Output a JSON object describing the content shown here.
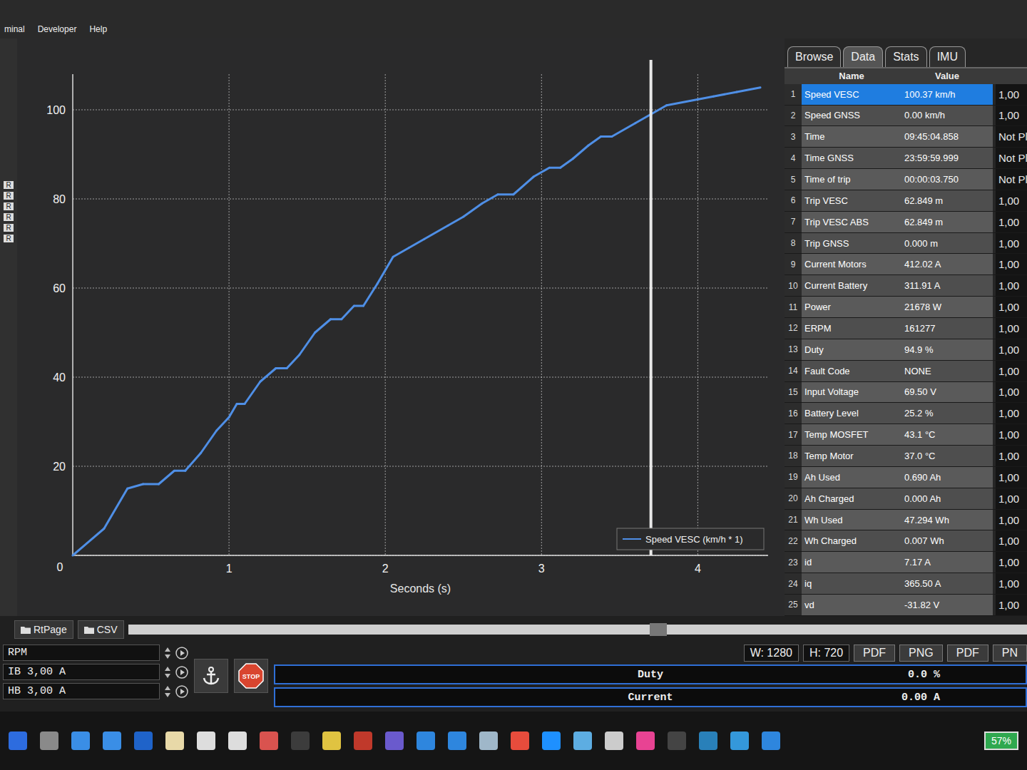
{
  "menu": [
    "minal",
    "Developer",
    "Help"
  ],
  "left_strip": [
    "R",
    "R",
    "R",
    "R",
    "R",
    "R"
  ],
  "chart": {
    "y_ticks": [
      "0",
      "20",
      "40",
      "60",
      "80",
      "100"
    ],
    "x_ticks": [
      "1",
      "2",
      "3",
      "4"
    ],
    "x_label": "Seconds (s)",
    "cursor": 3.7,
    "series": [
      {
        "name": "Speed VESC (km/h * 1)",
        "color": "#4f8fe6",
        "times": [
          0,
          0.2,
          0.35,
          0.45,
          0.55,
          0.65,
          0.72,
          0.82,
          0.92,
          1.0,
          1.05,
          1.1,
          1.2,
          1.3,
          1.37,
          1.45,
          1.55,
          1.65,
          1.72,
          1.8,
          1.86,
          1.95,
          2.05,
          2.15,
          2.25,
          2.4,
          2.5,
          2.62,
          2.72,
          2.82,
          2.95,
          3.05,
          3.12,
          3.2,
          3.3,
          3.38,
          3.45,
          3.6,
          3.7,
          3.8,
          3.95,
          4.1,
          4.25,
          4.4
        ],
        "values": [
          0,
          6,
          15,
          16,
          16,
          19,
          19,
          23,
          28,
          31,
          34,
          34,
          39,
          42,
          42,
          45,
          50,
          53,
          53,
          56,
          56,
          61,
          67,
          69,
          71,
          74,
          76,
          79,
          81,
          81,
          85,
          87,
          87,
          89,
          92,
          94,
          94,
          97,
          99,
          101,
          102,
          103,
          104,
          105
        ]
      }
    ]
  },
  "tabs": [
    {
      "label": "Browse",
      "selected": false
    },
    {
      "label": "Data",
      "selected": true
    },
    {
      "label": "Stats",
      "selected": false
    },
    {
      "label": "IMU",
      "selected": false
    }
  ],
  "table": {
    "columns": [
      "Name",
      "Value"
    ],
    "rows": [
      {
        "index": "1",
        "name": "Speed VESC",
        "value": "100.37 km/h",
        "scale": "1,00",
        "selected": true
      },
      {
        "index": "2",
        "name": "Speed GNSS",
        "value": "0.00 km/h",
        "scale": "1,00",
        "selected": false
      },
      {
        "index": "3",
        "name": "Time",
        "value": "09:45:04.858",
        "scale": "Not Pl",
        "selected": false
      },
      {
        "index": "4",
        "name": "Time GNSS",
        "value": "23:59:59.999",
        "scale": "Not Pl",
        "selected": false
      },
      {
        "index": "5",
        "name": "Time of trip",
        "value": "00:00:03.750",
        "scale": "Not Pl",
        "selected": false
      },
      {
        "index": "6",
        "name": "Trip VESC",
        "value": "62.849 m",
        "scale": "1,00",
        "selected": false
      },
      {
        "index": "7",
        "name": "Trip VESC ABS",
        "value": "62.849 m",
        "scale": "1,00",
        "selected": false
      },
      {
        "index": "8",
        "name": "Trip GNSS",
        "value": "0.000 m",
        "scale": "1,00",
        "selected": false
      },
      {
        "index": "9",
        "name": "Current Motors",
        "value": "412.02 A",
        "scale": "1,00",
        "selected": false
      },
      {
        "index": "10",
        "name": "Current Battery",
        "value": "311.91 A",
        "scale": "1,00",
        "selected": false
      },
      {
        "index": "11",
        "name": "Power",
        "value": "21678 W",
        "scale": "1,00",
        "selected": false
      },
      {
        "index": "12",
        "name": "ERPM",
        "value": "161277",
        "scale": "1,00",
        "selected": false
      },
      {
        "index": "13",
        "name": "Duty",
        "value": "94.9 %",
        "scale": "1,00",
        "selected": false
      },
      {
        "index": "14",
        "name": "Fault Code",
        "value": "NONE",
        "scale": "1,00",
        "selected": false
      },
      {
        "index": "15",
        "name": "Input Voltage",
        "value": "69.50 V",
        "scale": "1,00",
        "selected": false
      },
      {
        "index": "16",
        "name": "Battery Level",
        "value": "25.2 %",
        "scale": "1,00",
        "selected": false
      },
      {
        "index": "17",
        "name": "Temp MOSFET",
        "value": "43.1 °C",
        "scale": "1,00",
        "selected": false
      },
      {
        "index": "18",
        "name": "Temp Motor",
        "value": "37.0 °C",
        "scale": "1,00",
        "selected": false
      },
      {
        "index": "19",
        "name": "Ah Used",
        "value": "0.690 Ah",
        "scale": "1,00",
        "selected": false
      },
      {
        "index": "20",
        "name": "Ah Charged",
        "value": "0.000 Ah",
        "scale": "1,00",
        "selected": false
      },
      {
        "index": "21",
        "name": "Wh Used",
        "value": "47.294 Wh",
        "scale": "1,00",
        "selected": false
      },
      {
        "index": "22",
        "name": "Wh Charged",
        "value": "0.007 Wh",
        "scale": "1,00",
        "selected": false
      },
      {
        "index": "23",
        "name": "id",
        "value": "7.17 A",
        "scale": "1,00",
        "selected": false
      },
      {
        "index": "24",
        "name": "iq",
        "value": "365.50 A",
        "scale": "1,00",
        "selected": false
      },
      {
        "index": "25",
        "name": "vd",
        "value": "-31.82 V",
        "scale": "1,00",
        "selected": false
      }
    ]
  },
  "page_buttons": [
    "RtPage",
    "CSV"
  ],
  "controls": [
    "RPM",
    "IB 3,00 A",
    "HB 3,00 A"
  ],
  "stop": "STOP",
  "export": {
    "width": "W: 1280",
    "height": "H: 720",
    "buttons": [
      "PDF",
      "PNG",
      "PDF",
      "PN"
    ]
  },
  "meters": [
    {
      "name": "Duty",
      "reading": "0.0 %",
      "level": 0
    },
    {
      "name": "Current",
      "reading": "0.00 A",
      "level": 0
    }
  ],
  "taskbar": {
    "apps": [
      "#2d6cdf",
      "#8a8a8a",
      "#3a8ee6",
      "#3a8ee6",
      "#1f63c9",
      "#e8d9a8",
      "#dddddd",
      "#dddddd",
      "#d9534f",
      "#3c3c3c",
      "#e0c341",
      "#c0392b",
      "#6a5acd",
      "#2e86de",
      "#2e86de",
      "#9fb7c9",
      "#e74c3c",
      "#1e90ff",
      "#5dade2",
      "#cccccc",
      "#e84393",
      "#444444",
      "#2980b9",
      "#3498db",
      "#2e86de"
    ],
    "battery": "57%"
  }
}
